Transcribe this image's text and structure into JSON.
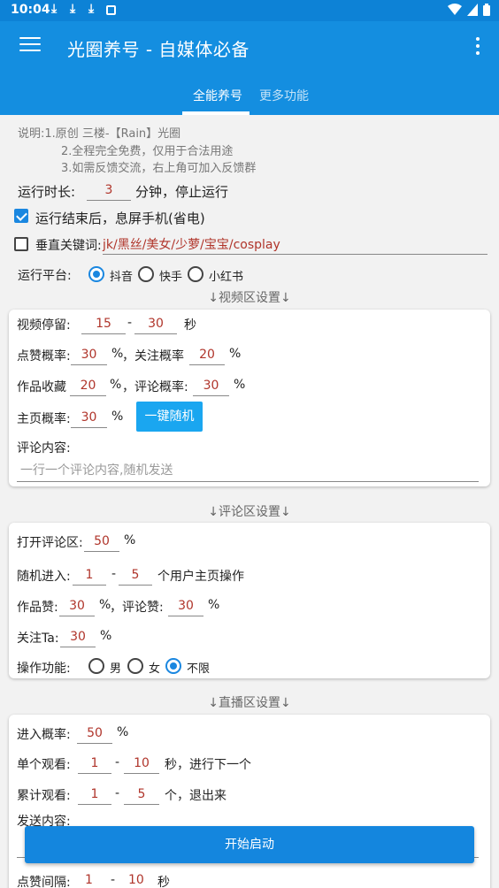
{
  "status": {
    "time": "10:04"
  },
  "appbar": {
    "title": "光圈养号 - 自媒体必备"
  },
  "tabs": [
    {
      "label": "全能养号"
    },
    {
      "label": "更多功能"
    }
  ],
  "notes": {
    "line1": "说明:1.原创 三楼-【Rain】光圈",
    "line2": "2.全程完全免费，仅用于合法用途",
    "line3": "3.如需反馈交流，右上角可加入反馈群"
  },
  "runtime": {
    "label": "运行时长:",
    "value": "3",
    "suffix": "分钟，停止运行"
  },
  "screen_off": {
    "label": "运行结束后，息屏手机(省电)",
    "checked": true
  },
  "keyword": {
    "label": "垂直关键词:",
    "value": "jk/黑丝/美女/少萝/宝宝/cosplay",
    "checked": false
  },
  "platform": {
    "label": "运行平台:",
    "options": [
      "抖音",
      "快手",
      "小红书"
    ],
    "selected": "抖音"
  },
  "video": {
    "title": "↓视频区设置↓",
    "stay_label": "视频停留:",
    "stay_min": "15",
    "dash": "-",
    "stay_max": "30",
    "stay_unit": "秒",
    "like_label": "点赞概率:",
    "like": "30",
    "pct": "%",
    "follow_label": "，关注概率",
    "follow": "20",
    "collect_label": "作品收藏",
    "collect": "20",
    "comment_label": "，评论概率:",
    "comment": "30",
    "home_label": "主页概率:",
    "home": "30",
    "random_btn": "一键随机",
    "content_label": "评论内容:",
    "content_placeholder": "一行一个评论内容,随机发送"
  },
  "comment": {
    "title": "↓评论区设置↓",
    "open_label": "打开评论区:",
    "open": "50",
    "enter_label": "随机进入:",
    "enter_min": "1",
    "enter_max": "5",
    "enter_suffix": "个用户主页操作",
    "work_like_label": "作品赞:",
    "work_like": "30",
    "comment_like_label": "，评论赞:",
    "comment_like": "30",
    "follow_label": "关注Ta:",
    "follow": "30",
    "gender_label": "操作功能:",
    "gender_options": [
      "男",
      "女",
      "不限"
    ],
    "gender_selected": "不限"
  },
  "live": {
    "title": "↓直播区设置↓",
    "enter_label": "进入概率:",
    "enter": "50",
    "single_label": "单个观看:",
    "single_min": "1",
    "single_max": "10",
    "single_suffix": "秒，进行下一个",
    "total_label": "累计观看:",
    "total_min": "1",
    "total_max": "5",
    "total_suffix": "个，退出来",
    "send_label": "发送内容:",
    "interval_label": "点赞间隔:",
    "interval_min": "1",
    "interval_max": "10",
    "interval_unit": "秒"
  },
  "start_button": "开始启动",
  "colors": {
    "primary": "#148ee0",
    "accent": "#1a87e0",
    "value_text": "#b0352b",
    "random_btn": "#1aa6f0"
  }
}
